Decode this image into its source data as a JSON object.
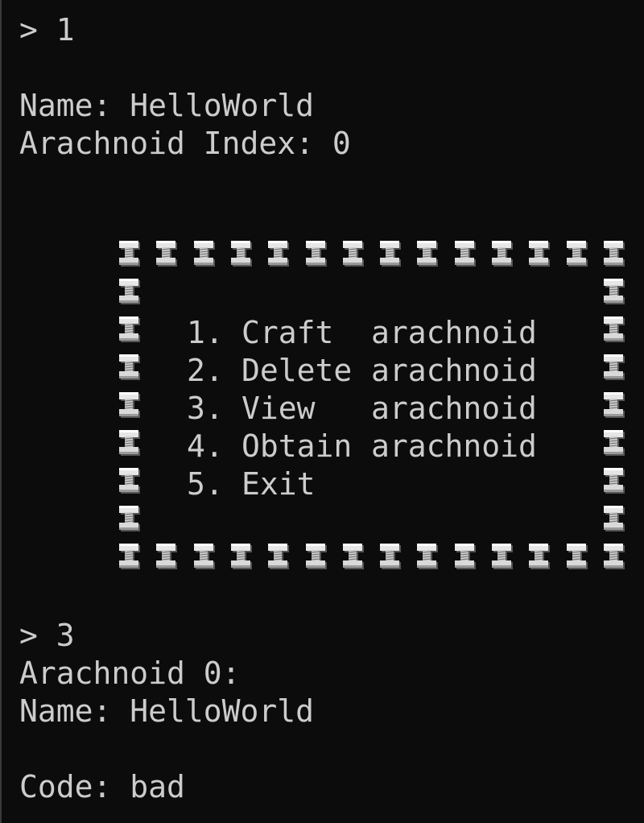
{
  "prompt1": "> 1",
  "created": {
    "name": "Name: HelloWorld",
    "index": "Arachnoid Index: 0"
  },
  "menu": {
    "frame_icon": "bolt-icon",
    "items": [
      {
        "num": "1.",
        "verb": "Craft",
        "noun": "arachnoid"
      },
      {
        "num": "2.",
        "verb": "Delete",
        "noun": "arachnoid"
      },
      {
        "num": "3.",
        "verb": "View",
        "noun": "arachnoid"
      },
      {
        "num": "4.",
        "verb": "Obtain",
        "noun": "arachnoid"
      },
      {
        "num": "5.",
        "verb": "Exit",
        "noun": ""
      }
    ]
  },
  "prompt2": "> 3",
  "view": {
    "header": "Arachnoid 0:",
    "name": "Name: HelloWorld",
    "code": "Code: bad"
  },
  "colors": {
    "background": "#0c0c0c",
    "text": "#cccccc"
  }
}
